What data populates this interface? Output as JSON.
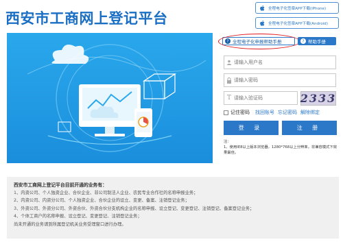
{
  "header": {
    "title": "西安市工商网上登记平台",
    "ios_download": "全程电子化签章APP下载(iPhone)",
    "android_download": "全程电子化签章APP下载(Android)"
  },
  "login": {
    "help_main": "全程电子化申报帮助手册",
    "help_side": "帮助手册",
    "username_placeholder": "请输入用户名",
    "password_placeholder": "请输入密码",
    "code_placeholder": "请输入验证码",
    "captcha": "2333",
    "remember": "记住密码",
    "links": [
      "找回账号",
      "忘记密码",
      "解除绑定"
    ],
    "login_button": "登 录",
    "register_button": "注 册",
    "notes": [
      "注：",
      "1、使用IE8以上版本浏览器，1280*768以上分辨率，非兼容模式下效果最佳。"
    ]
  },
  "info": {
    "title": "西安市工商网上登记平台目前开通的业务有：",
    "lines": [
      "1、内资公司、个人独资企业、合伙企业、非公司制法人企业、农民专业合作社的名称申报业务；",
      "2、内资公司、内资分公司、个人独资企业、合伙企业的设立、变更、备案、注销登记业务；",
      "3、外资公司、外资分公司、外资合伙、外资合伙分支机构企业的名称申报、设立登记、变更登记、注销登记、备案登记业务；",
      "4、个体工商户的名称申报、设立登记、变更登记、注销登记业务；",
      "尚未开通的业务请到所属登记机关业务受理窗口进行办理。"
    ]
  },
  "colors": {
    "brand_blue": "#1a6fc4",
    "button_blue": "#2b78c8",
    "banner_blue": "#1a8edc",
    "highlight_red": "#e0161a"
  }
}
